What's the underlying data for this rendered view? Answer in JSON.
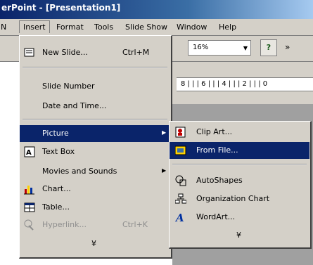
{
  "window": {
    "title": "erPoint - [Presentation1]"
  },
  "menubar": {
    "items": [
      {
        "label": "Insert"
      },
      {
        "label": "Format"
      },
      {
        "label": "Tools"
      },
      {
        "label": "Slide Show"
      },
      {
        "label": "Window"
      },
      {
        "label": "Help"
      }
    ],
    "left_fragment": "N"
  },
  "toolbar": {
    "zoom_value": "16%",
    "overflow_glyph": "»"
  },
  "ruler": {
    "text": "8 | | | 6 | | | 4 | | | 2 | | | 0"
  },
  "insert_menu": {
    "items": [
      {
        "label": "New Slide...",
        "shortcut": "Ctrl+M",
        "icon": "new-slide-icon"
      },
      {
        "label": "Slide Number"
      },
      {
        "label": "Date and Time..."
      },
      {
        "label": "Picture",
        "icon": "picture-icon",
        "submenu": true
      },
      {
        "label": "Text Box",
        "icon": "text-box-icon"
      },
      {
        "label": "Movies and Sounds",
        "submenu": true
      },
      {
        "label": "Chart...",
        "icon": "chart-icon"
      },
      {
        "label": "Table...",
        "icon": "table-icon"
      },
      {
        "label": "Hyperlink...",
        "shortcut": "Ctrl+K",
        "icon": "hyperlink-icon",
        "disabled": true
      }
    ],
    "expand_glyph": "¥"
  },
  "picture_submenu": {
    "items": [
      {
        "label": "Clip Art...",
        "icon": "clip-art-icon"
      },
      {
        "label": "From File...",
        "icon": "from-file-icon"
      },
      {
        "label": "AutoShapes",
        "icon": "autoshapes-icon"
      },
      {
        "label": "Organization Chart",
        "icon": "org-chart-icon"
      },
      {
        "label": "WordArt...",
        "icon": "wordart-icon"
      }
    ],
    "expand_glyph": "¥"
  },
  "colors": {
    "highlight": "#0a246a",
    "face": "#d4d0c8",
    "workspace": "#a0a0a0"
  }
}
